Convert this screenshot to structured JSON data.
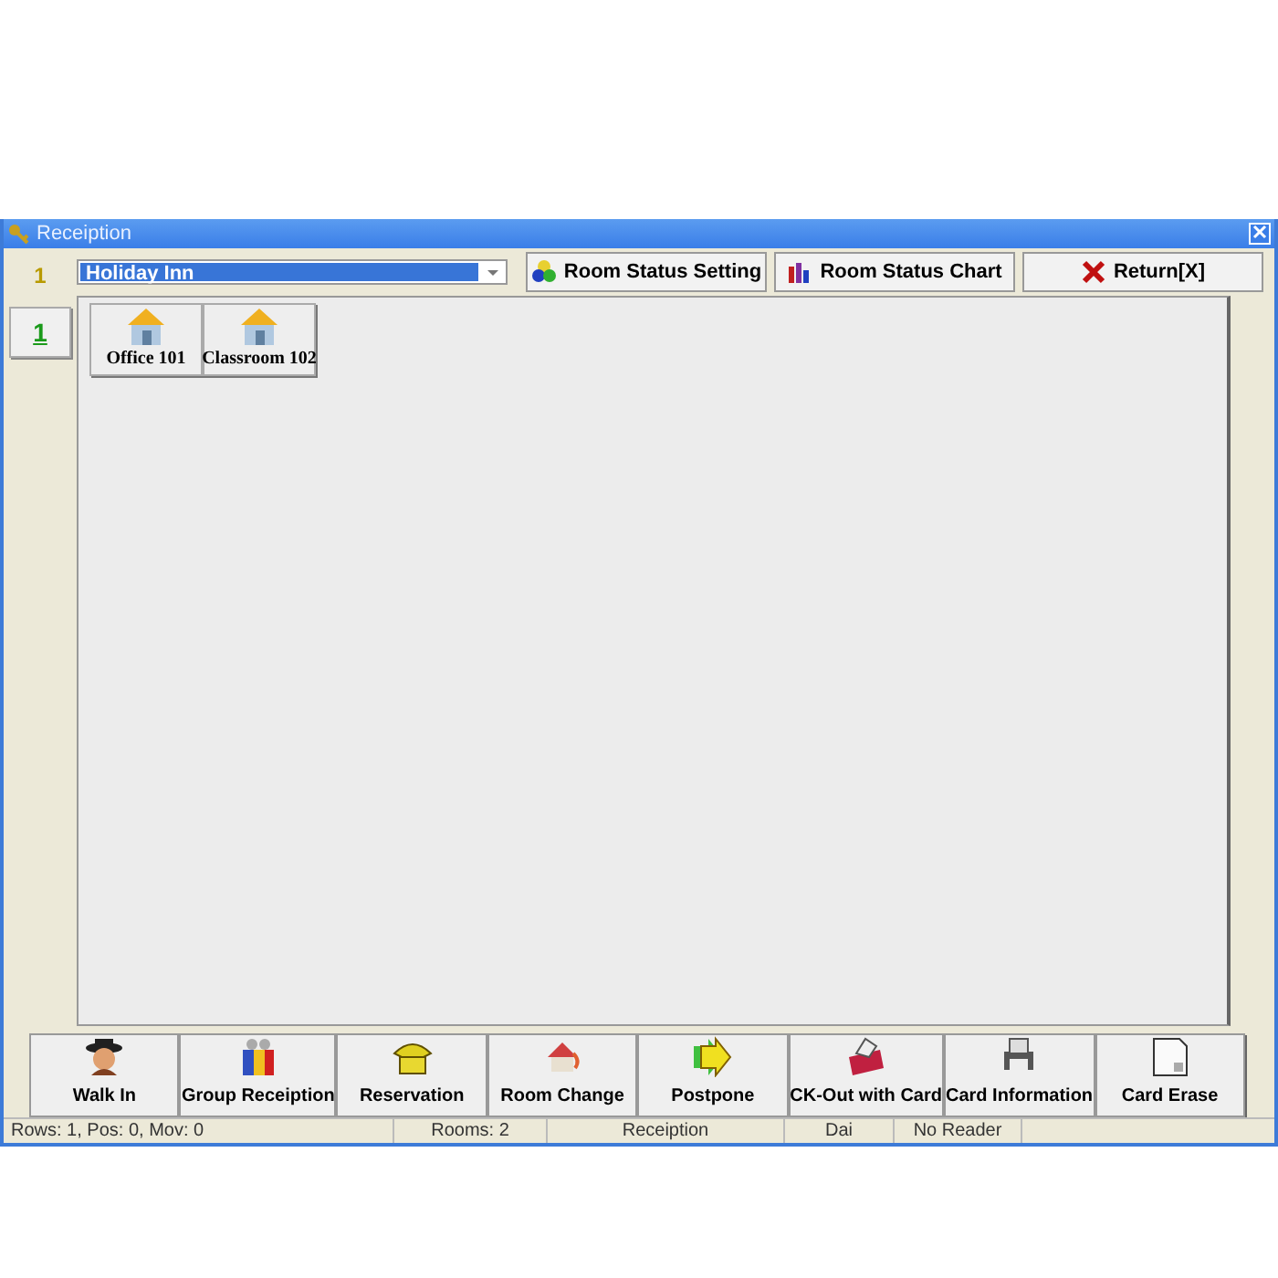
{
  "window": {
    "title": "Receiption"
  },
  "floor_label": "1",
  "floor_tabs": [
    {
      "label": "1",
      "selected": true
    }
  ],
  "hotel_select": {
    "value": "Holiday Inn"
  },
  "toolbar": [
    {
      "kind": "setting",
      "label": "Room Status Setting"
    },
    {
      "kind": "chart",
      "label": "Room Status Chart"
    },
    {
      "kind": "return",
      "label": "Return[X]"
    }
  ],
  "rooms": [
    {
      "label": "Office 101"
    },
    {
      "label": "Classroom 102"
    }
  ],
  "actions": [
    {
      "kind": "walkin",
      "label": "Walk In"
    },
    {
      "kind": "group",
      "label": "Group Receiption"
    },
    {
      "kind": "phone",
      "label": "Reservation"
    },
    {
      "kind": "change",
      "label": "Room Change"
    },
    {
      "kind": "postpone",
      "label": "Postpone"
    },
    {
      "kind": "checkout",
      "label": "CK-Out with Card"
    },
    {
      "kind": "info",
      "label": "Card Information"
    },
    {
      "kind": "erase",
      "label": "Card Erase"
    }
  ],
  "status_bar": [
    "Rows: 1, Pos: 0, Mov: 0",
    "Rooms:  2",
    "Receiption",
    "Dai",
    "No Reader"
  ]
}
